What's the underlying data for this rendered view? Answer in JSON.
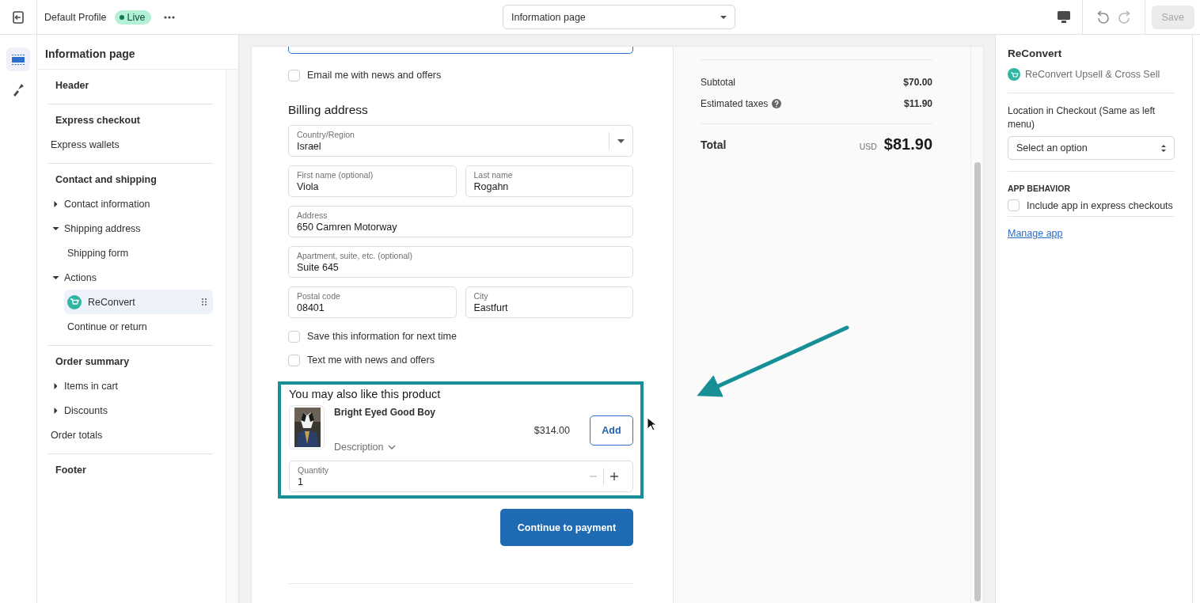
{
  "topbar": {
    "profile": "Default Profile",
    "status": "Live",
    "page_select": "Information page",
    "save": "Save"
  },
  "sidebar": {
    "title": "Information page",
    "tree": [
      {
        "label": "Header",
        "kind": "section",
        "selected": false
      },
      {
        "label": "Express checkout",
        "kind": "section",
        "selected": false,
        "children": [
          {
            "label": "Express wallets",
            "kind": "item",
            "selected": false
          }
        ]
      },
      {
        "label": "Contact and shipping",
        "kind": "section",
        "selected": false,
        "children": [
          {
            "label": "Contact information",
            "kind": "group",
            "expanded": false,
            "selected": false
          },
          {
            "label": "Shipping address",
            "kind": "group",
            "expanded": true,
            "selected": false,
            "children": [
              {
                "label": "Shipping form",
                "kind": "item",
                "selected": false
              }
            ]
          },
          {
            "label": "Actions",
            "kind": "group",
            "expanded": true,
            "selected": false,
            "children": [
              {
                "label": "ReConvert",
                "kind": "app",
                "selected": true
              },
              {
                "label": "Continue or return",
                "kind": "item",
                "selected": false
              }
            ]
          }
        ]
      },
      {
        "label": "Order summary",
        "kind": "section",
        "selected": false,
        "children": [
          {
            "label": "Items in cart",
            "kind": "group",
            "expanded": false,
            "selected": false
          },
          {
            "label": "Discounts",
            "kind": "group",
            "expanded": false,
            "selected": false
          },
          {
            "label": "Order totals",
            "kind": "item",
            "selected": false
          }
        ]
      },
      {
        "label": "Footer",
        "kind": "section",
        "selected": false
      }
    ]
  },
  "checkout": {
    "email_option": {
      "label": "Email me with news and offers",
      "checked": false
    },
    "billing_heading": "Billing address",
    "field_rows": [
      [
        {
          "label": "Country/Region",
          "value": "Israel",
          "kind": "select"
        }
      ],
      [
        {
          "label": "First name (optional)",
          "value": "Viola",
          "kind": "text"
        },
        {
          "label": "Last name",
          "value": "Rogahn",
          "kind": "text"
        }
      ],
      [
        {
          "label": "Address",
          "value": "650 Camren Motorway",
          "kind": "text"
        }
      ],
      [
        {
          "label": "Apartment, suite, etc. (optional)",
          "value": "Suite 645",
          "kind": "text"
        }
      ],
      [
        {
          "label": "Postal code",
          "value": "08401",
          "kind": "text"
        },
        {
          "label": "City",
          "value": "Eastfurt",
          "kind": "text"
        }
      ]
    ],
    "options": [
      {
        "label": "Save this information for next time",
        "checked": false
      },
      {
        "label": "Text me with news and offers",
        "checked": false
      }
    ],
    "upsell": {
      "heading": "You may also like this product",
      "product": "Bright Eyed Good Boy",
      "description": "Description",
      "price": "$314.00",
      "add_button": "Add",
      "quantity_label": "Quantity",
      "quantity": "1"
    },
    "continue_button": "Continue to payment"
  },
  "summary": {
    "lines": [
      {
        "label": "Subtotal",
        "value": "$70.00",
        "info": false
      },
      {
        "label": "Estimated taxes",
        "value": "$11.90",
        "info": true
      }
    ],
    "total": {
      "label": "Total",
      "currency": "USD",
      "value": "$81.90"
    }
  },
  "app_panel": {
    "title": "ReConvert",
    "app_name": "ReConvert Upsell & Cross Sell",
    "location_label": "Location in Checkout (Same as left menu)",
    "location_placeholder": "Select an option",
    "behavior_heading": "APP BEHAVIOR",
    "behavior_option": {
      "label": "Include app in express checkouts",
      "checked": false
    },
    "manage_link": "Manage app"
  }
}
